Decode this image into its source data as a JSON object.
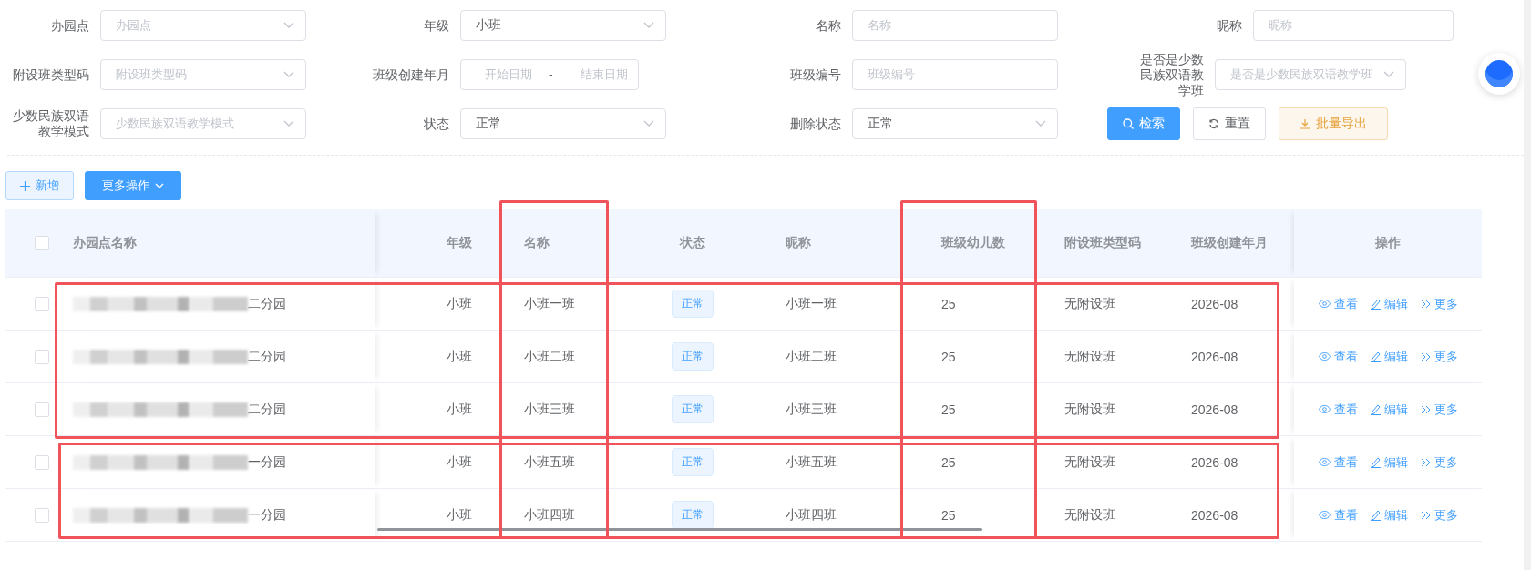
{
  "filters": [
    {
      "label": "办园点",
      "kind": "select",
      "placeholder": "办园点"
    },
    {
      "label": "年级",
      "kind": "select",
      "value": "小班"
    },
    {
      "label": "名称",
      "kind": "input",
      "placeholder": "名称"
    },
    {
      "label": "昵称",
      "kind": "input",
      "placeholder": "昵称"
    },
    {
      "label": "附设班类型码",
      "kind": "select",
      "placeholder": "附设班类型码"
    },
    {
      "label": "班级创建年月",
      "kind": "daterange",
      "start_placeholder": "开始日期",
      "separator": "-",
      "end_placeholder": "结束日期"
    },
    {
      "label": "班级编号",
      "kind": "input",
      "placeholder": "班级编号"
    },
    {
      "label": "是否是少数民族双语教学班",
      "kind": "select",
      "placeholder": "是否是少数民族双语教学班"
    },
    {
      "label": "少数民族双语教学模式",
      "kind": "select",
      "placeholder": "少数民族双语教学模式"
    },
    {
      "label": "状态",
      "kind": "select",
      "value": "正常"
    },
    {
      "label": "删除状态",
      "kind": "select",
      "value": "正常"
    }
  ],
  "search_buttons": [
    {
      "label": "检索",
      "kind": "primary"
    },
    {
      "label": "重置",
      "kind": "default"
    },
    {
      "label": "批量导出",
      "kind": "warning"
    }
  ],
  "toolbar": [
    {
      "label": "新增",
      "kind": "add"
    },
    {
      "label": "更多操作",
      "kind": "dropdown"
    }
  ],
  "table": {
    "all_checked": false,
    "columns": [
      "办园点名称",
      "年级",
      "名称",
      "状态",
      "昵称",
      "班级幼儿数",
      "附设班类型码",
      "班级创建年月",
      "操作"
    ],
    "rows": [
      {
        "checked": false,
        "site": "二分园",
        "grade": "小班",
        "name": "小班一班",
        "status": "正常",
        "nickname": "小班一班",
        "children": "25",
        "type_code": "无附设班",
        "created": "2026-08",
        "actions": [
          "查看",
          "编辑",
          "更多"
        ]
      },
      {
        "checked": false,
        "site": "二分园",
        "grade": "小班",
        "name": "小班二班",
        "status": "正常",
        "nickname": "小班二班",
        "children": "25",
        "type_code": "无附设班",
        "created": "2026-08",
        "actions": [
          "查看",
          "编辑",
          "更多"
        ]
      },
      {
        "checked": false,
        "site": "二分园",
        "grade": "小班",
        "name": "小班三班",
        "status": "正常",
        "nickname": "小班三班",
        "children": "25",
        "type_code": "无附设班",
        "created": "2026-08",
        "actions": [
          "查看",
          "编辑",
          "更多"
        ]
      },
      {
        "checked": false,
        "site": "一分园",
        "grade": "小班",
        "name": "小班五班",
        "status": "正常",
        "nickname": "小班五班",
        "children": "25",
        "type_code": "无附设班",
        "created": "2026-08",
        "actions": [
          "查看",
          "编辑",
          "更多"
        ]
      },
      {
        "checked": false,
        "site": "一分园",
        "grade": "小班",
        "name": "小班四班",
        "status": "正常",
        "nickname": "小班四班",
        "children": "25",
        "type_code": "无附设班",
        "created": "2026-08",
        "actions": [
          "查看",
          "编辑",
          "更多"
        ]
      }
    ]
  }
}
